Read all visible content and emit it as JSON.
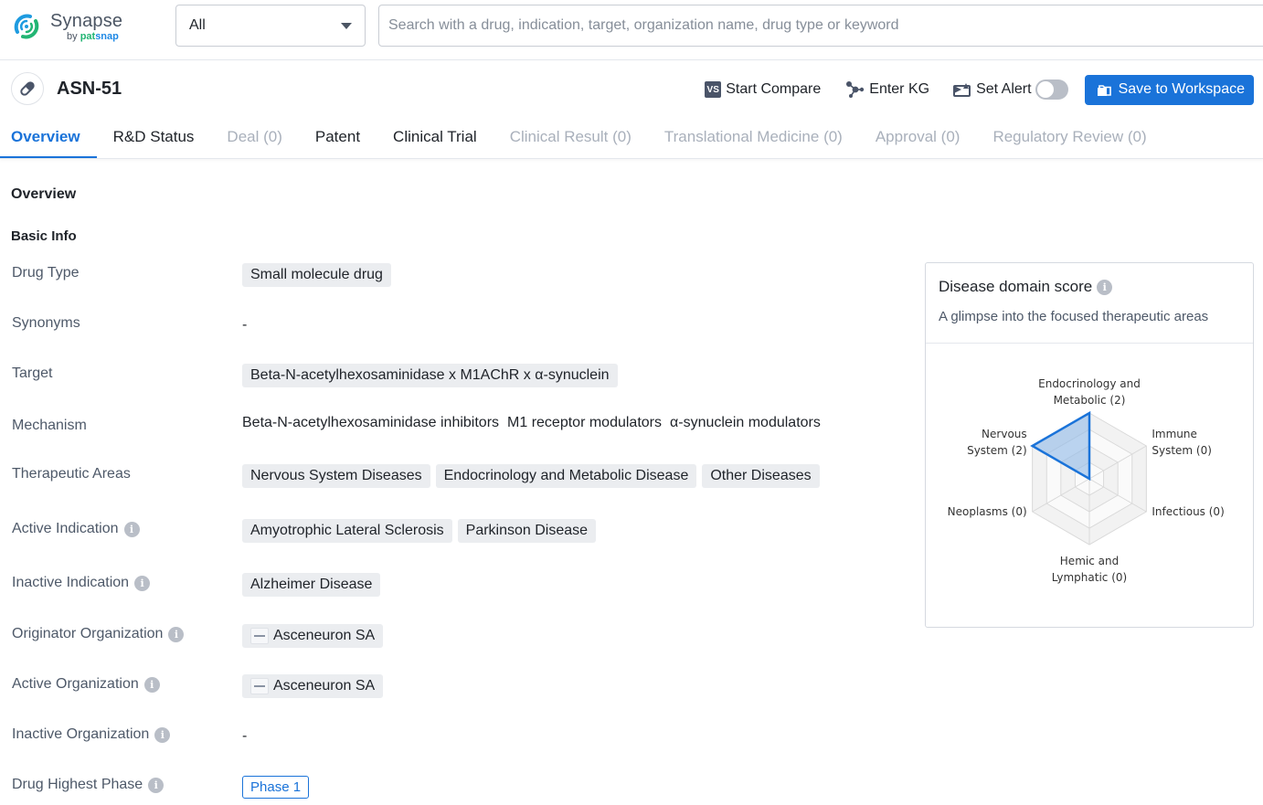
{
  "app": {
    "logo_name": "Synapse",
    "logo_by": "by",
    "logo_brand_a": "pat",
    "logo_brand_b": "snap"
  },
  "search": {
    "scope_value": "All",
    "placeholder": "Search with a drug, indication, target, organization name, drug type or keyword",
    "value": ""
  },
  "drug": {
    "title": "ASN-51",
    "icon": "pill-icon"
  },
  "actions": {
    "compare_label": "Start Compare",
    "compare_icon_text": "VS",
    "kg_label": "Enter KG",
    "alert_label": "Set Alert",
    "alert_enabled": false,
    "save_label": "Save to Workspace"
  },
  "tabs": [
    {
      "label": "Overview",
      "state": "active"
    },
    {
      "label": "R&D Status",
      "state": "normal"
    },
    {
      "label": "Deal (0)",
      "state": "disabled"
    },
    {
      "label": "Patent",
      "state": "normal"
    },
    {
      "label": "Clinical Trial",
      "state": "normal"
    },
    {
      "label": "Clinical Result (0)",
      "state": "disabled"
    },
    {
      "label": "Translational Medicine (0)",
      "state": "disabled"
    },
    {
      "label": "Approval (0)",
      "state": "disabled"
    },
    {
      "label": "Regulatory Review (0)",
      "state": "disabled"
    }
  ],
  "overview": {
    "section_title": "Overview",
    "basic_info_title": "Basic Info",
    "rows": {
      "drug_type": {
        "label": "Drug Type",
        "chips": [
          "Small molecule drug"
        ]
      },
      "synonyms": {
        "label": "Synonyms",
        "value": "-"
      },
      "target": {
        "label": "Target",
        "chips": [
          "Beta-N-acetylhexosaminidase x M1AChR x α-synuclein"
        ]
      },
      "mechanism": {
        "label": "Mechanism",
        "items": [
          "Beta-N-acetylhexosaminidase inhibitors",
          "M1 receptor modulators",
          "α-synuclein modulators"
        ]
      },
      "therapeutic_areas": {
        "label": "Therapeutic Areas",
        "chips": [
          "Nervous System Diseases",
          "Endocrinology and Metabolic Disease",
          "Other Diseases"
        ]
      },
      "active_indication": {
        "label": "Active Indication",
        "chips": [
          "Amyotrophic Lateral Sclerosis",
          "Parkinson Disease"
        ]
      },
      "inactive_indication": {
        "label": "Inactive Indication",
        "chips": [
          "Alzheimer Disease"
        ]
      },
      "originator_org": {
        "label": "Originator Organization",
        "chips": [
          "Asceneuron SA"
        ]
      },
      "active_org": {
        "label": "Active Organization",
        "chips": [
          "Asceneuron SA"
        ]
      },
      "inactive_org": {
        "label": "Inactive Organization",
        "value": "-"
      },
      "highest_phase": {
        "label": "Drug Highest Phase",
        "value": "Phase 1"
      }
    }
  },
  "domain_card": {
    "title": "Disease domain score",
    "subtitle": "A glimpse into the focused therapeutic areas"
  },
  "colors": {
    "accent": "#1a73d9",
    "radar_fill": "#8fb9e8",
    "muted_tab": "#a9b0bb"
  },
  "chart_data": {
    "type": "radar",
    "title": "Disease domain score",
    "max": 2,
    "levels": 4,
    "axes": [
      {
        "label_lines": [
          "Endocrinology and",
          "Metabolic (2)"
        ],
        "name": "Endocrinology and Metabolic",
        "value": 2
      },
      {
        "label_lines": [
          "Immune",
          "System (0)"
        ],
        "name": "Immune System",
        "value": 0
      },
      {
        "label_lines": [
          "Infectious (0)"
        ],
        "name": "Infectious",
        "value": 0
      },
      {
        "label_lines": [
          "Hemic and",
          "Lymphatic (0)"
        ],
        "name": "Hemic and Lymphatic",
        "value": 0
      },
      {
        "label_lines": [
          "Neoplasms (0)"
        ],
        "name": "Neoplasms",
        "value": 0
      },
      {
        "label_lines": [
          "Nervous",
          "System (2)"
        ],
        "name": "Nervous System",
        "value": 2
      }
    ]
  }
}
